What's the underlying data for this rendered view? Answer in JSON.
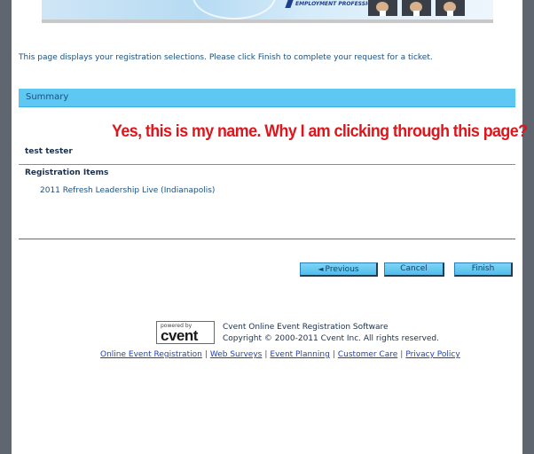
{
  "banner": {
    "tagline": "EMPLOYMENT PROFESSIONALS",
    "photos": [
      "person-photo",
      "person-photo",
      "person-photo"
    ]
  },
  "intro_text": "This page displays your registration selections. Please click Finish to complete your request for a ticket.",
  "summary": {
    "heading": "Summary",
    "attendee_name": "test tester",
    "items_heading": "Registration Items",
    "items": [
      "2011 Refresh Leadership Live (Indianapolis)"
    ]
  },
  "annotation": "Yes, this is my name. Why I am clicking through this page?",
  "buttons": {
    "previous_arrow": "◄",
    "previous": "Previous",
    "cancel": "Cancel",
    "finish": "Finish"
  },
  "footer": {
    "logo_small": "powered by",
    "logo_word": "cvent",
    "line1": "Cvent Online Event Registration Software",
    "line2": "Copyright © 2000-2011 Cvent Inc. All rights reserved.",
    "links": [
      "Online Event Registration",
      "Web Surveys",
      "Event Planning",
      "Customer Care",
      "Privacy Policy"
    ],
    "separator": "|"
  },
  "colors": {
    "summary_bar": "#5ec8f2",
    "annotation": "#e0141b",
    "link": "#2244aa",
    "text_blue": "#1b4f80"
  }
}
